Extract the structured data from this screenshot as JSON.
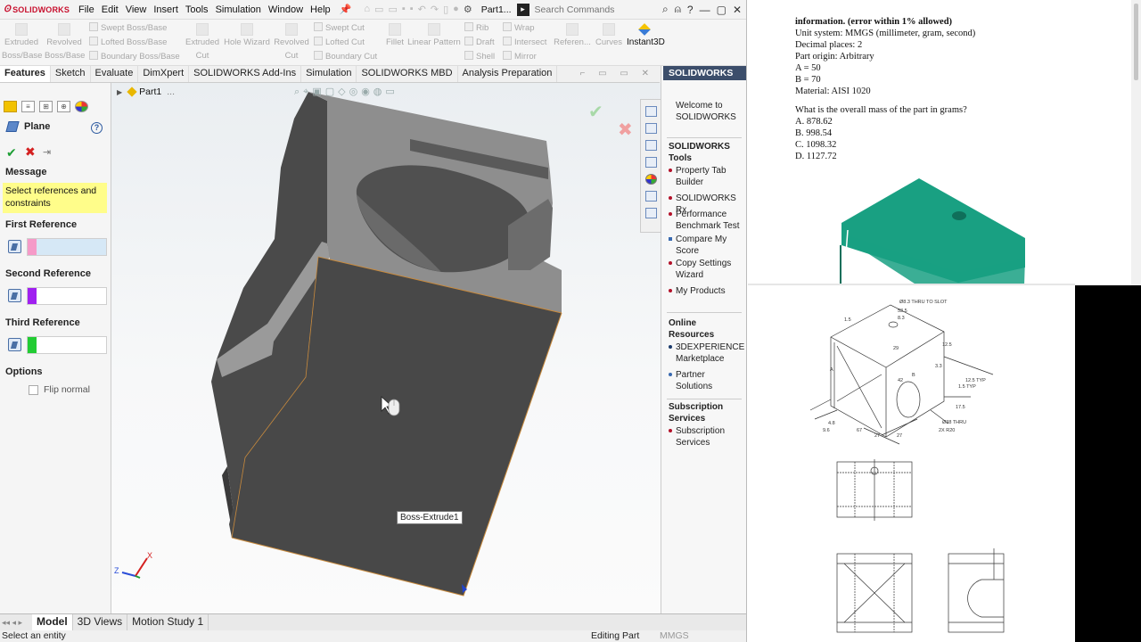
{
  "app": {
    "brand": "SOLIDWORKS",
    "menu": [
      "File",
      "Edit",
      "View",
      "Insert",
      "Tools",
      "Simulation",
      "Window",
      "Help"
    ],
    "doc_title": "Part1...",
    "search_placeholder": "Search Commands"
  },
  "command_manager": {
    "extruded_boss": "Extruded Boss/Base",
    "revolved_boss": "Revolved Boss/Base",
    "swept_boss": "Swept Boss/Base",
    "lofted_boss": "Lofted Boss/Base",
    "boundary_boss": "Boundary Boss/Base",
    "extruded_cut": "Extruded Cut",
    "hole_wizard": "Hole Wizard",
    "revolved_cut": "Revolved Cut",
    "swept_cut": "Swept Cut",
    "lofted_cut": "Lofted Cut",
    "boundary_cut": "Boundary Cut",
    "fillet": "Fillet",
    "linear_pattern": "Linear Pattern",
    "rib": "Rib",
    "draft": "Draft",
    "shell": "Shell",
    "wrap": "Wrap",
    "intersect": "Intersect",
    "mirror": "Mirror",
    "reference": "Referen...",
    "curves": "Curves",
    "instant3d": "Instant3D"
  },
  "tabs": [
    "Features",
    "Sketch",
    "Evaluate",
    "DimXpert",
    "SOLIDWORKS Add-Ins",
    "Simulation",
    "SOLIDWORKS MBD",
    "Analysis Preparation"
  ],
  "property_manager": {
    "title": "Plane",
    "message_head": "Message",
    "message": "Select references and constraints",
    "first_ref": "First Reference",
    "second_ref": "Second Reference",
    "third_ref": "Third Reference",
    "options": "Options",
    "flip_normal": "Flip normal",
    "colors": {
      "first": "#f59ac8",
      "second": "#a020f0",
      "third": "#22cc33"
    }
  },
  "viewport": {
    "tree_part": "Part1",
    "tooltip": "Boss-Extrude1",
    "triad_z": "Z",
    "triad_x": "X"
  },
  "task_pane": {
    "header": "SOLIDWORKS",
    "welcome": "Welcome to SOLIDWORKS",
    "tools_head": "SOLIDWORKS Tools",
    "tools": [
      "Property Tab Builder",
      "SOLIDWORKS Rx",
      "Performance Benchmark Test",
      "Compare My Score",
      "Copy Settings Wizard",
      "My Products"
    ],
    "online_head": "Online Resources",
    "online": [
      "3DEXPERIENCE Marketplace",
      "Partner Solutions"
    ],
    "subs_head": "Subscription Services",
    "subs": [
      "Subscription Services"
    ]
  },
  "bottom_tabs": [
    "Model",
    "3D Views",
    "Motion Study 1"
  ],
  "status": {
    "left": "Select an entity",
    "mid": "Editing Part",
    "units": "MMGS"
  },
  "pdf": {
    "lines": [
      "information. (error within 1% allowed)",
      "Unit system: MMGS (millimeter, gram, second)",
      "Decimal places: 2",
      "Part origin: Arbitrary",
      "A = 50",
      "B = 70",
      "Material: AISI 1020",
      "",
      "What is the overall mass of the part in grams?",
      "A. 878.62",
      "B. 998.54",
      "C. 1098.32",
      "D. 1127.72"
    ],
    "drawing_labels": {
      "thru_slot": "Ø8.3 THRU TO SLOT",
      "d1": "53.5",
      "d2": "8.3",
      "d3": "1.5",
      "d4": "29",
      "d5": "12.5",
      "d6": "3.3",
      "d7": "42",
      "d8": "12.5 TYP",
      "d9": "1.5 TYP",
      "d10": "17.5",
      "d11": "Ø38 THRU",
      "d12": "2X R20",
      "d13": "4.8",
      "d14": "9.6",
      "d15": "67",
      "d16": "27",
      "d17": "27",
      "d18": "A",
      "d19": "B"
    },
    "model_color": "#19a082"
  }
}
